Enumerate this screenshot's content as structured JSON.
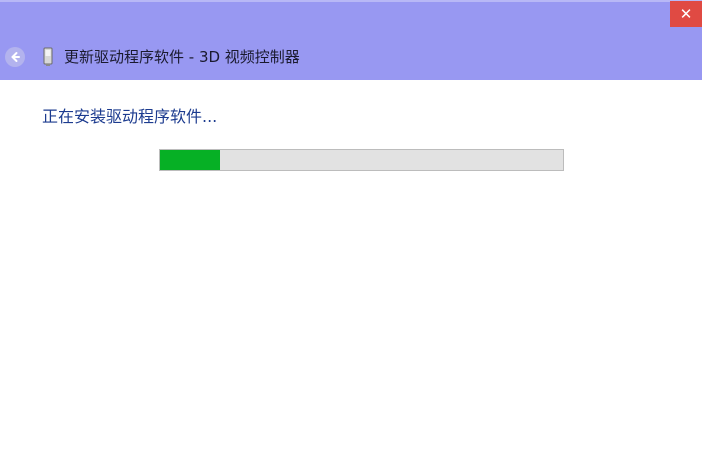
{
  "window": {
    "title": "更新驱动程序软件 - 3D 视频控制器",
    "close_label": "✕",
    "back_icon": "back-arrow-icon",
    "device_icon": "device-icon",
    "close_color": "#e04a43",
    "title_bar_color": "#9898f2"
  },
  "content": {
    "status_text": "正在安装驱动程序软件...",
    "status_color": "#1c3b8f",
    "progress": {
      "value": 0.15,
      "fill_color": "#06b025",
      "track_color": "#e2e2e2"
    }
  }
}
